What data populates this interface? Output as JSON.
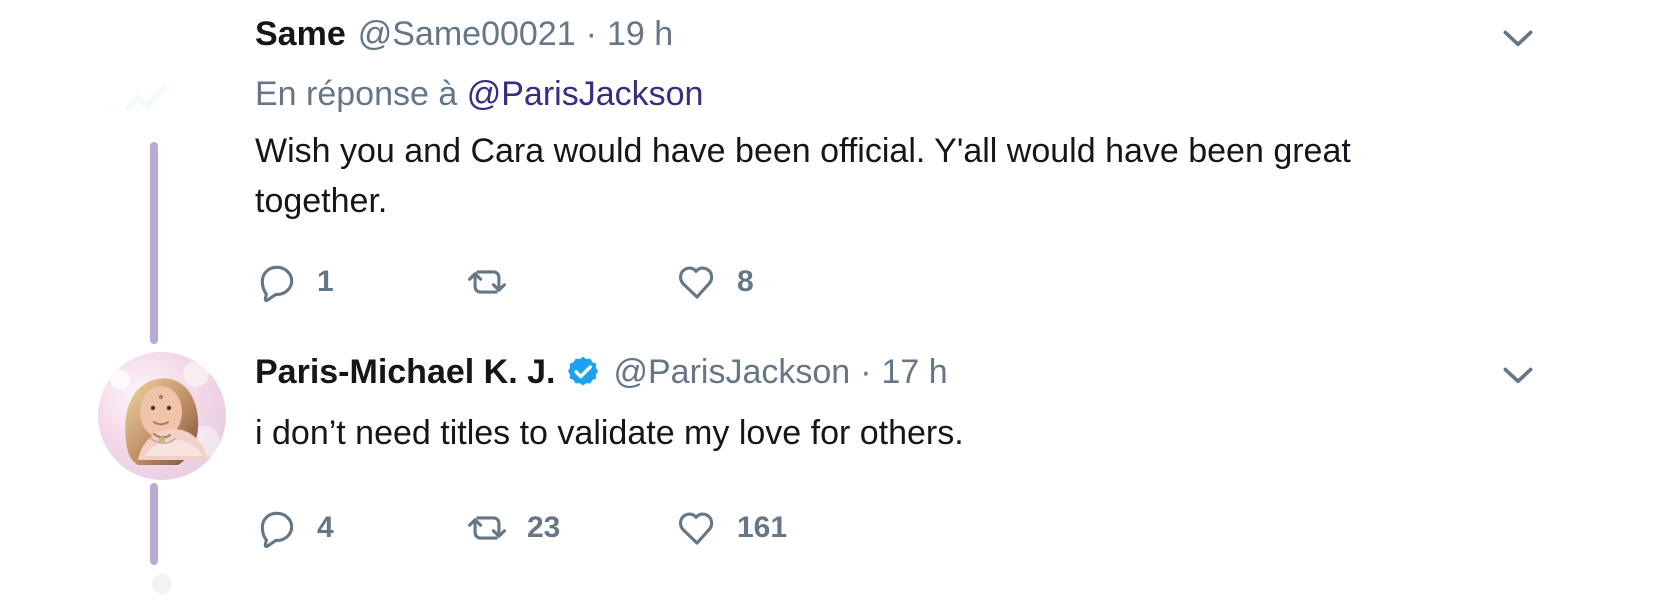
{
  "colors": {
    "text_primary": "#14171a",
    "text_secondary": "#657786",
    "mention": "#3b2b82",
    "thread": "#b8a9d6",
    "verified": "#1da1f2"
  },
  "tweets": [
    {
      "name": "Same",
      "handle": "@Same00021",
      "separator": "·",
      "time": "19 h",
      "reply_prefix": "En réponse à",
      "reply_to": "@ParisJackson",
      "text": "Wish you and Cara would have been official. Y'all would have been great together.",
      "actions": {
        "reply_count": "1",
        "retweet_count": "",
        "like_count": "8"
      },
      "menu_icon": "chevron-down-icon"
    },
    {
      "name": "Paris-Michael K. J.",
      "verified_icon": "verified-badge-icon",
      "handle": "@ParisJackson",
      "separator": "·",
      "time": "17 h",
      "text": "i don’t need titles to validate my love for others.",
      "actions": {
        "reply_count": "4",
        "retweet_count": "23",
        "like_count": "161"
      },
      "menu_icon": "chevron-down-icon",
      "avatar_icon": "avatar"
    }
  ]
}
